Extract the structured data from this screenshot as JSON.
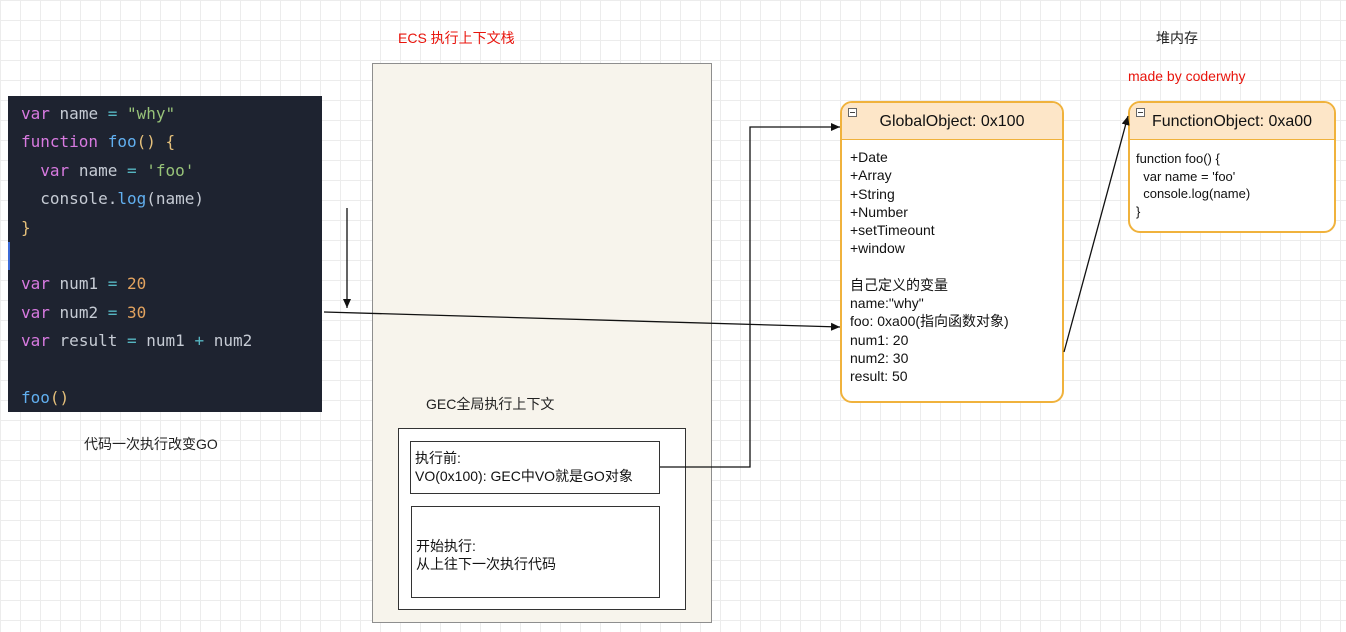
{
  "labels": {
    "ecs_title": "ECS 执行上下文栈",
    "heap_title": "堆内存",
    "made_by": "made by coderwhy",
    "code_caption": "代码一次执行改变GO",
    "gec_title": "GEC全局执行上下文"
  },
  "code": {
    "l1": {
      "kw": "var",
      "name": "name",
      "eq": "=",
      "val": "\"why\""
    },
    "l2": {
      "kw": "function",
      "fn": "foo",
      "paren": "()",
      "brace": "{"
    },
    "l3": {
      "kw": "var",
      "name": "name",
      "eq": "=",
      "val": "'foo'"
    },
    "l4": {
      "obj": "console.",
      "fn": "log",
      "args": "(name)"
    },
    "l5": {
      "brace": "}"
    },
    "l7": {
      "kw": "var",
      "name": "num1",
      "eq": "=",
      "val": "20"
    },
    "l8": {
      "kw": "var",
      "name": "num2",
      "eq": "=",
      "val": "30"
    },
    "l9": {
      "kw": "var",
      "name": "result",
      "eq": "=",
      "a": "num1",
      "plus": "+",
      "b": "num2"
    },
    "l11": {
      "fn": "foo",
      "paren": "()"
    }
  },
  "gec": {
    "before_title": "执行前:",
    "before_text": "VO(0x100): GEC中VO就是GO对象",
    "start_title": "开始执行:",
    "start_text": "从上往下一次执行代码"
  },
  "global_object": {
    "title": "GlobalObject: 0x100",
    "builtins": [
      "+Date",
      "+Array",
      "+String",
      "+Number",
      "+setTimeount",
      "+window"
    ],
    "custom_title": "自己定义的变量",
    "vars": [
      "name:\"why\"",
      "foo: 0xa00(指向函数对象)",
      "num1: 20",
      "num2: 30",
      "result: 50"
    ]
  },
  "function_object": {
    "title": "FunctionObject: 0xa00",
    "lines": [
      "function foo() {",
      "  var name = 'foo'",
      "  console.log(name)",
      "}"
    ]
  },
  "colors": {
    "accent_orange": "#f0b23c",
    "header_fill": "#fde6c8",
    "red_text": "#e8140c",
    "code_bg": "#1e2330"
  }
}
